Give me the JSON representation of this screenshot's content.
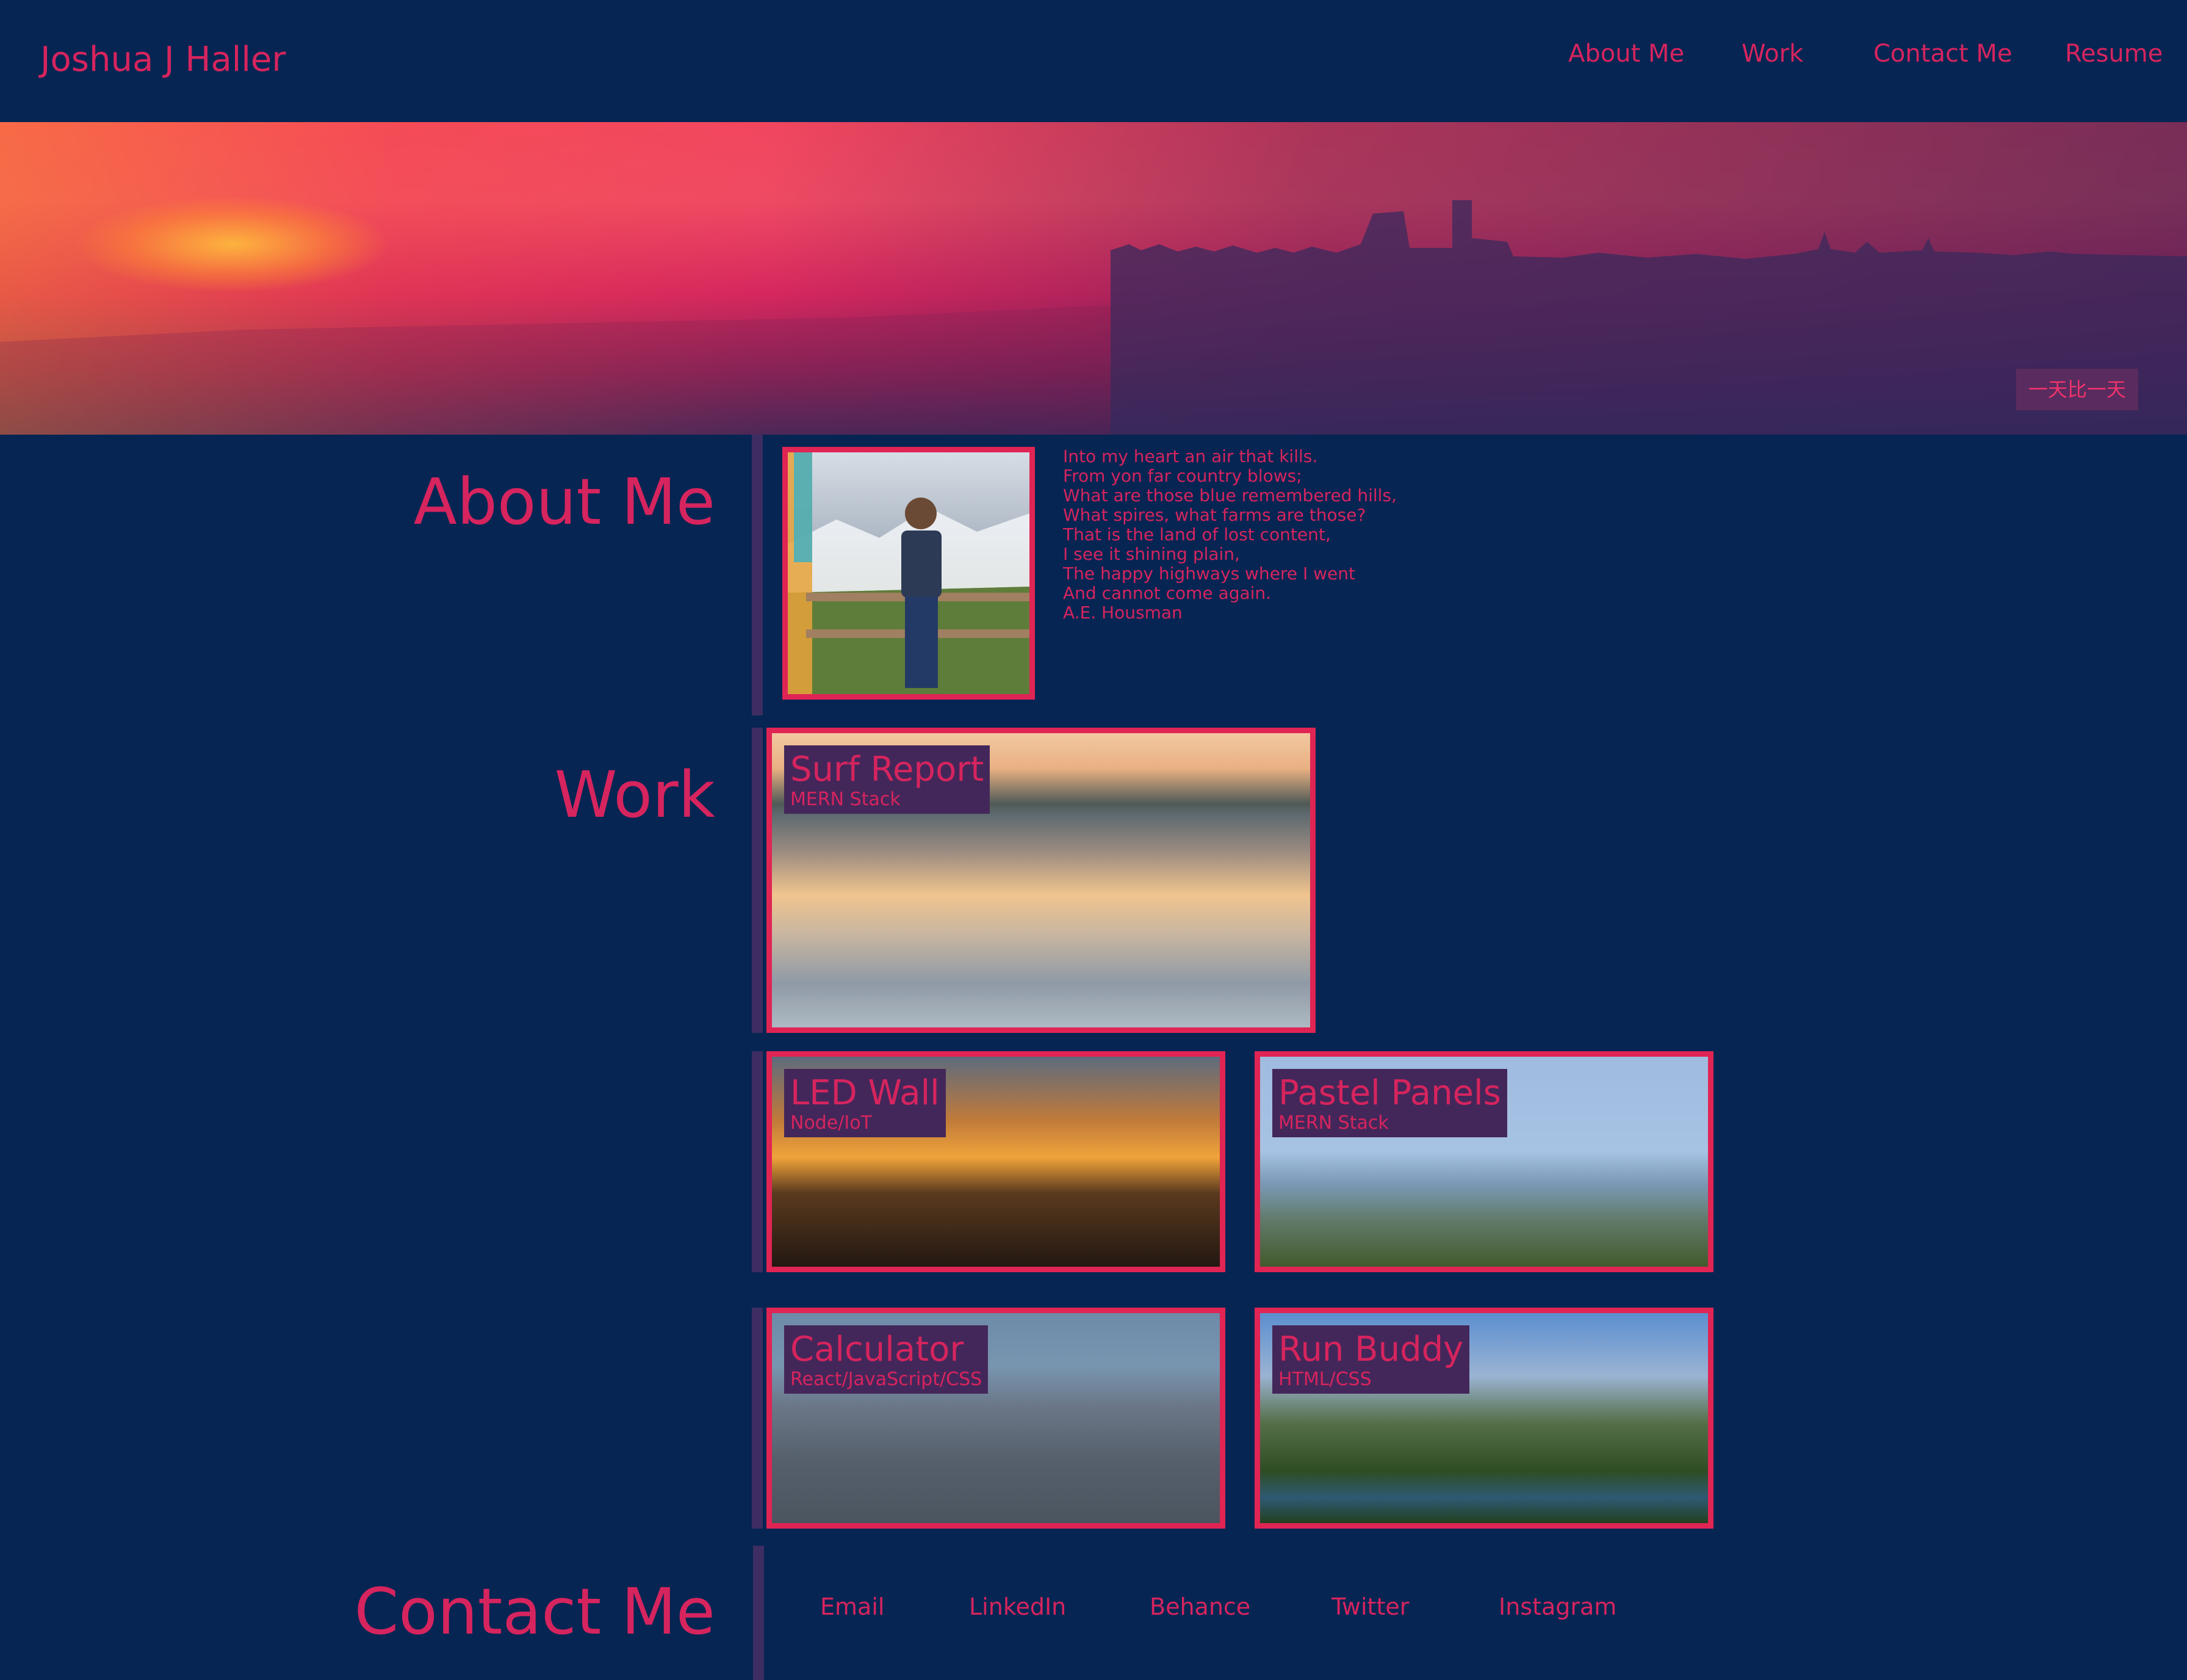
{
  "header": {
    "title": "Joshua J Haller",
    "nav": [
      "About Me",
      "Work",
      "Contact Me",
      "Resume"
    ]
  },
  "banner": {
    "badge": "一天比一天"
  },
  "about": {
    "heading": "About Me",
    "poem": [
      "Into my heart an air that kills.",
      "From yon far country blows;",
      "What are those blue remembered hills,",
      "What spires, what farms are those?",
      "That is the land of lost content,",
      "I see it shining plain,",
      "The happy highways where I went",
      "And cannot come again.",
      "A.E. Housman"
    ]
  },
  "work": {
    "heading": "Work",
    "projects": [
      {
        "title": "Surf Report",
        "stack": "MERN Stack"
      },
      {
        "title": "LED Wall",
        "stack": "Node/IoT"
      },
      {
        "title": "Pastel Panels",
        "stack": "MERN Stack"
      },
      {
        "title": "Calculator",
        "stack": "React/JavaScript/CSS"
      },
      {
        "title": "Run Buddy",
        "stack": "HTML/CSS"
      }
    ]
  },
  "contact": {
    "heading": "Contact Me",
    "links": [
      "Email",
      "LinkedIn",
      "Behance",
      "Twitter",
      "Instagram"
    ]
  },
  "colors": {
    "background": "#062553",
    "accent": "#d6245e",
    "label_bg": "#44275a",
    "separator": "#3d2d62"
  }
}
